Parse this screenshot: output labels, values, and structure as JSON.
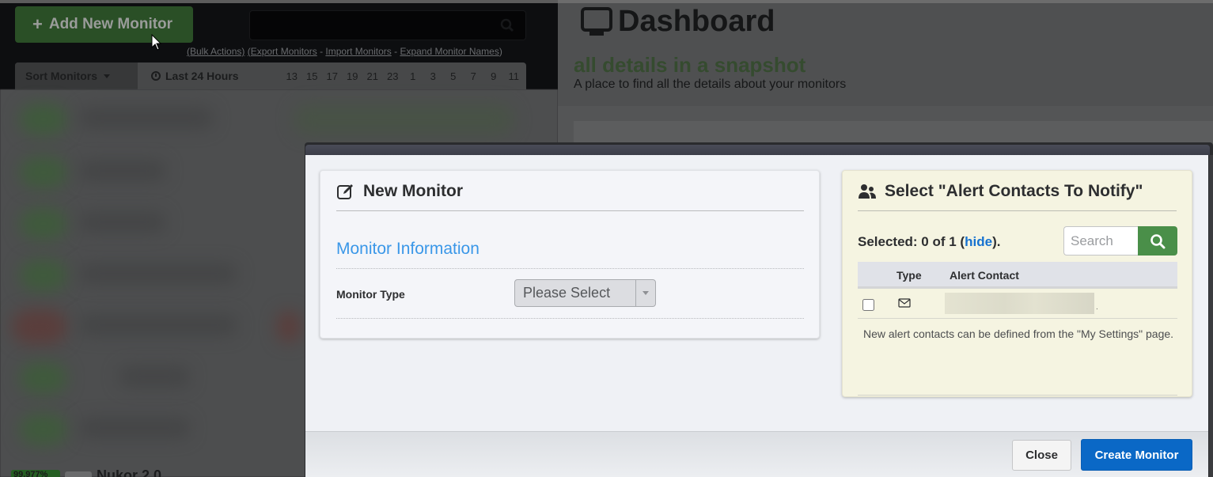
{
  "background": {
    "left_panel": {
      "add_monitor_label": "Add New Monitor",
      "bulk_links": {
        "bulk_actions": "(Bulk Actions)",
        "export": "(Export Monitors",
        "separator1": " - ",
        "import": "Import Monitors",
        "separator2": " - ",
        "expand": "Expand Monitor Names",
        "close_paren": ")"
      },
      "sort_label": "Sort Monitors",
      "time_range_label": "Last 24 Hours",
      "hours": [
        "13",
        "15",
        "17",
        "19",
        "21",
        "23",
        "1",
        "3",
        "5",
        "7",
        "9",
        "11"
      ],
      "last_monitor": {
        "uptime_badge": "99.977%",
        "name": "Nukor 2.0"
      }
    },
    "dashboard": {
      "title": "Dashboard",
      "tagline": "all details in a snapshot",
      "subtitle": "A place to find all the details about your monitors"
    }
  },
  "modal": {
    "new_monitor": {
      "title": "New Monitor",
      "section_title": "Monitor Information",
      "monitor_type_label": "Monitor Type",
      "monitor_type_value": "Please Select"
    },
    "alert_contacts": {
      "title": "Select \"Alert Contacts To Notify\"",
      "selected_prefix": "Selected: 0 of 1 (",
      "hide_link": "hide",
      "selected_suffix": ").",
      "search_placeholder": "Search",
      "columns": [
        "",
        "Type",
        "Alert Contact"
      ],
      "rows": [
        {
          "checked": false,
          "type_icon": "mail-icon",
          "contact": ""
        }
      ],
      "help_text": "New alert contacts can be defined from the \"My Settings\" page."
    },
    "footer": {
      "close_label": "Close",
      "create_label": "Create Monitor"
    }
  },
  "colors": {
    "section_title": "#3a97e8",
    "link": "#1672d0",
    "search_button": "#4a8f49",
    "primary_button": "#0a68c6",
    "contacts_panel_bg": "#f5f4e1"
  }
}
